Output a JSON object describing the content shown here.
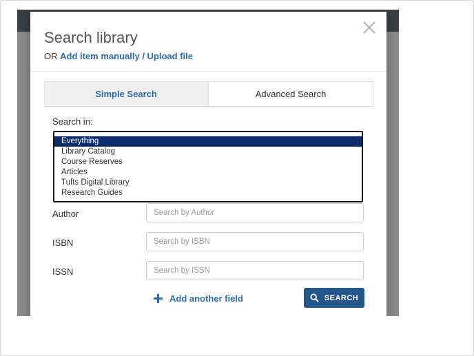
{
  "modal": {
    "title": "Search library",
    "subtitle_prefix": "OR",
    "add_manual_link": "Add item manually",
    "separator": " / ",
    "upload_link": "Upload file"
  },
  "tabs": [
    {
      "label": "Simple Search",
      "active": false
    },
    {
      "label": "Advanced Search",
      "active": true
    }
  ],
  "search_in": {
    "label": "Search in:",
    "options": [
      "Everything",
      "Library Catalog",
      "Course Reserves",
      "Articles",
      "Tufts Digital Library",
      "Research Guides"
    ],
    "selected": "Everything"
  },
  "fields": [
    {
      "label": "Author",
      "placeholder": "Search by Author"
    },
    {
      "label": "ISBN",
      "placeholder": "Search by ISBN"
    },
    {
      "label": "ISSN",
      "placeholder": "Search by ISSN"
    }
  ],
  "add_field_label": "Add another field",
  "search_button_label": "SEARCH",
  "colors": {
    "link": "#2d6ba8",
    "button": "#23568a",
    "selected_option": "#0c2d6b",
    "overlay": "#8a8a8a"
  },
  "icons": [
    "close-icon",
    "plus-icon",
    "search-icon"
  ]
}
